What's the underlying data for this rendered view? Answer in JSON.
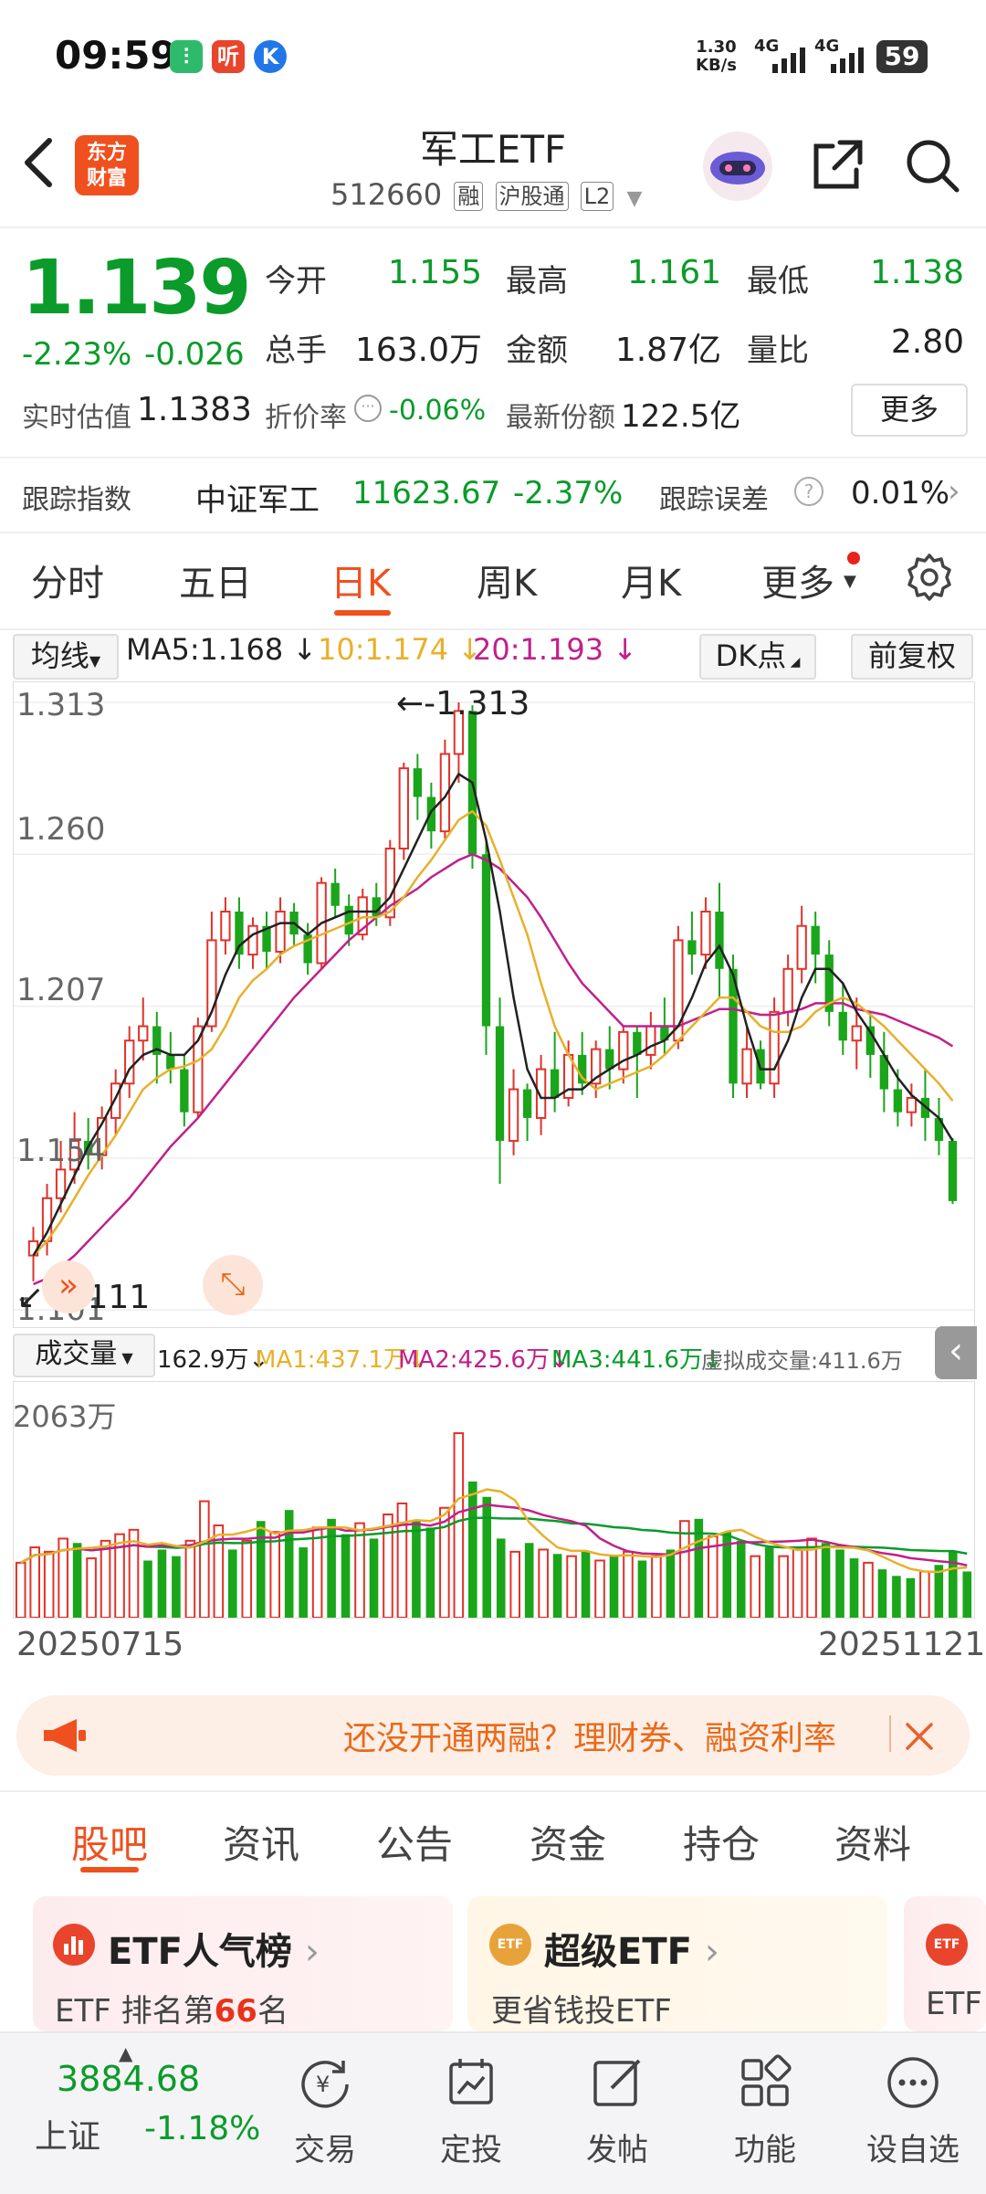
{
  "status_bar": {
    "time": "09:59",
    "net_speed": "1.30",
    "net_unit": "KB/s",
    "signal1": "4G",
    "signal2": "4G",
    "battery": "59",
    "app_icons": [
      "#2fba6b",
      "#e8452c",
      "#2176e8"
    ],
    "app_glyphs": [
      "⫶",
      "听",
      "K"
    ]
  },
  "header": {
    "logo_line1": "东方",
    "logo_line2": "财富",
    "title": "军工ETF",
    "code": "512660",
    "tags": [
      "融",
      "沪股通",
      "L2"
    ]
  },
  "quote": {
    "price": "1.139",
    "change_pct": "-2.23%",
    "change": "-0.026",
    "open_label": "今开",
    "open": "1.155",
    "high_label": "最高",
    "high": "1.161",
    "low_label": "最低",
    "low": "1.138",
    "volume_label": "总手",
    "volume": "163.0万",
    "amount_label": "金额",
    "amount": "1.87亿",
    "ratio_label": "量比",
    "ratio": "2.80",
    "iopv_label": "实时估值",
    "iopv": "1.1383",
    "discount_label": "折价率",
    "discount": "-0.06%",
    "shares_label": "最新份额",
    "shares": "122.5亿",
    "more": "更多"
  },
  "tracking": {
    "label": "跟踪指数",
    "index_name": "中证军工",
    "index_value": "11623.67",
    "index_change": "-2.37%",
    "error_label": "跟踪误差",
    "error_value": "0.01%"
  },
  "period_tabs": [
    "分时",
    "五日",
    "日K",
    "周K",
    "月K",
    "更多"
  ],
  "ma_row": {
    "selector": "均线",
    "ma5": "MA5:1.168",
    "ma10": "10:1.174",
    "ma20": "20:1.193",
    "dk": "DK点",
    "adjust": "前复权"
  },
  "chart_data": {
    "type": "candlestick",
    "y_ticks": [
      "1.313",
      "1.260",
      "1.207",
      "1.154",
      "1.101"
    ],
    "ylim": [
      1.095,
      1.32
    ],
    "max_label": "1.313",
    "min_label": "1.111",
    "x_start": "20250715",
    "x_end": "20251121",
    "candles": [
      [
        1.12,
        1.125,
        1.111,
        1.13
      ],
      [
        1.125,
        1.14,
        1.12,
        1.145
      ],
      [
        1.14,
        1.15,
        1.135,
        1.16
      ],
      [
        1.15,
        1.16,
        1.145,
        1.17
      ],
      [
        1.16,
        1.155,
        1.15,
        1.168
      ],
      [
        1.155,
        1.168,
        1.15,
        1.172
      ],
      [
        1.168,
        1.18,
        1.162,
        1.185
      ],
      [
        1.18,
        1.195,
        1.175,
        1.2
      ],
      [
        1.195,
        1.2,
        1.188,
        1.21
      ],
      [
        1.2,
        1.19,
        1.18,
        1.205
      ],
      [
        1.19,
        1.185,
        1.18,
        1.198
      ],
      [
        1.185,
        1.17,
        1.165,
        1.19
      ],
      [
        1.17,
        1.2,
        1.168,
        1.203
      ],
      [
        1.2,
        1.23,
        1.198,
        1.24
      ],
      [
        1.23,
        1.24,
        1.225,
        1.245
      ],
      [
        1.24,
        1.225,
        1.22,
        1.245
      ],
      [
        1.225,
        1.235,
        1.22,
        1.238
      ],
      [
        1.235,
        1.226,
        1.22,
        1.24
      ],
      [
        1.226,
        1.24,
        1.222,
        1.245
      ],
      [
        1.24,
        1.232,
        1.228,
        1.243
      ],
      [
        1.232,
        1.222,
        1.218,
        1.236
      ],
      [
        1.222,
        1.25,
        1.22,
        1.252
      ],
      [
        1.25,
        1.242,
        1.238,
        1.255
      ],
      [
        1.242,
        1.232,
        1.228,
        1.246
      ],
      [
        1.232,
        1.245,
        1.23,
        1.248
      ],
      [
        1.245,
        1.238,
        1.235,
        1.25
      ],
      [
        1.238,
        1.262,
        1.235,
        1.265
      ],
      [
        1.262,
        1.29,
        1.258,
        1.292
      ],
      [
        1.29,
        1.28,
        1.272,
        1.295
      ],
      [
        1.28,
        1.268,
        1.262,
        1.285
      ],
      [
        1.268,
        1.295,
        1.265,
        1.3
      ],
      [
        1.295,
        1.31,
        1.285,
        1.313
      ],
      [
        1.31,
        1.26,
        1.255,
        1.312
      ],
      [
        1.26,
        1.2,
        1.19,
        1.265
      ],
      [
        1.2,
        1.16,
        1.145,
        1.21
      ],
      [
        1.16,
        1.178,
        1.155,
        1.185
      ],
      [
        1.178,
        1.168,
        1.16,
        1.18
      ],
      [
        1.168,
        1.185,
        1.162,
        1.19
      ],
      [
        1.185,
        1.175,
        1.17,
        1.198
      ],
      [
        1.175,
        1.19,
        1.172,
        1.195
      ],
      [
        1.19,
        1.18,
        1.176,
        1.198
      ],
      [
        1.18,
        1.192,
        1.175,
        1.195
      ],
      [
        1.192,
        1.185,
        1.178,
        1.2
      ],
      [
        1.185,
        1.198,
        1.18,
        1.2
      ],
      [
        1.198,
        1.19,
        1.175,
        1.2
      ],
      [
        1.19,
        1.2,
        1.185,
        1.205
      ],
      [
        1.2,
        1.195,
        1.19,
        1.21
      ],
      [
        1.195,
        1.23,
        1.192,
        1.235
      ],
      [
        1.23,
        1.225,
        1.218,
        1.24
      ],
      [
        1.225,
        1.24,
        1.22,
        1.245
      ],
      [
        1.24,
        1.22,
        1.21,
        1.25
      ],
      [
        1.22,
        1.18,
        1.175,
        1.225
      ],
      [
        1.18,
        1.192,
        1.175,
        1.2
      ],
      [
        1.192,
        1.18,
        1.178,
        1.195
      ],
      [
        1.18,
        1.205,
        1.175,
        1.21
      ],
      [
        1.205,
        1.22,
        1.2,
        1.225
      ],
      [
        1.22,
        1.235,
        1.215,
        1.242
      ],
      [
        1.235,
        1.225,
        1.215,
        1.24
      ],
      [
        1.225,
        1.205,
        1.2,
        1.23
      ],
      [
        1.205,
        1.195,
        1.19,
        1.215
      ],
      [
        1.195,
        1.2,
        1.185,
        1.21
      ],
      [
        1.2,
        1.19,
        1.182,
        1.205
      ],
      [
        1.19,
        1.178,
        1.17,
        1.198
      ],
      [
        1.178,
        1.17,
        1.165,
        1.185
      ],
      [
        1.17,
        1.175,
        1.165,
        1.18
      ],
      [
        1.175,
        1.168,
        1.16,
        1.185
      ],
      [
        1.168,
        1.16,
        1.155,
        1.175
      ],
      [
        1.16,
        1.139,
        1.138,
        1.161
      ]
    ],
    "ma5": [
      1.12,
      1.128,
      1.138,
      1.148,
      1.158,
      1.166,
      1.175,
      1.185,
      1.19,
      1.192,
      1.19,
      1.19,
      1.195,
      1.205,
      1.218,
      1.228,
      1.232,
      1.234,
      1.236,
      1.236,
      1.232,
      1.236,
      1.238,
      1.24,
      1.24,
      1.24,
      1.245,
      1.255,
      1.265,
      1.275,
      1.28,
      1.288,
      1.285,
      1.265,
      1.24,
      1.21,
      1.185,
      1.175,
      1.175,
      1.178,
      1.178,
      1.182,
      1.185,
      1.188,
      1.19,
      1.193,
      1.195,
      1.2,
      1.21,
      1.222,
      1.228,
      1.218,
      1.2,
      1.185,
      1.185,
      1.195,
      1.21,
      1.22,
      1.22,
      1.215,
      1.205,
      1.198,
      1.19,
      1.182,
      1.176,
      1.172,
      1.168,
      1.16
    ],
    "ma10": [
      1.12,
      1.125,
      1.132,
      1.14,
      1.148,
      1.155,
      1.162,
      1.17,
      1.178,
      1.182,
      1.185,
      1.186,
      1.188,
      1.192,
      1.2,
      1.21,
      1.216,
      1.22,
      1.225,
      1.228,
      1.23,
      1.232,
      1.234,
      1.236,
      1.238,
      1.238,
      1.24,
      1.245,
      1.252,
      1.258,
      1.265,
      1.272,
      1.275,
      1.27,
      1.258,
      1.245,
      1.232,
      1.215,
      1.2,
      1.19,
      1.182,
      1.178,
      1.18,
      1.182,
      1.184,
      1.186,
      1.19,
      1.195,
      1.2,
      1.205,
      1.21,
      1.21,
      1.205,
      1.2,
      1.198,
      1.198,
      1.2,
      1.205,
      1.208,
      1.21,
      1.208,
      1.204,
      1.2,
      1.195,
      1.19,
      1.185,
      1.18,
      1.174
    ],
    "ma20": [
      1.11,
      1.112,
      1.116,
      1.12,
      1.125,
      1.13,
      1.135,
      1.14,
      1.146,
      1.152,
      1.158,
      1.163,
      1.168,
      1.174,
      1.18,
      1.186,
      1.192,
      1.198,
      1.204,
      1.21,
      1.215,
      1.22,
      1.225,
      1.23,
      1.234,
      1.238,
      1.242,
      1.245,
      1.248,
      1.252,
      1.255,
      1.258,
      1.26,
      1.258,
      1.255,
      1.25,
      1.245,
      1.238,
      1.23,
      1.222,
      1.215,
      1.21,
      1.205,
      1.2,
      1.2,
      1.2,
      1.2,
      1.2,
      1.202,
      1.204,
      1.206,
      1.206,
      1.205,
      1.204,
      1.204,
      1.205,
      1.206,
      1.208,
      1.208,
      1.208,
      1.206,
      1.205,
      1.204,
      1.202,
      1.2,
      1.198,
      1.196,
      1.193
    ],
    "volume": {
      "label": "成交量",
      "current": "162.9万",
      "ma1": "MA1:437.1万",
      "ma2": "MA2:425.6万",
      "ma3": "MA3:441.6万",
      "virtual": "虚拟成交量:411.6万",
      "max_label": "2063万",
      "values": [
        500,
        640,
        600,
        720,
        680,
        540,
        700,
        760,
        800,
        520,
        620,
        560,
        700,
        1060,
        840,
        620,
        700,
        880,
        780,
        980,
        640,
        820,
        900,
        760,
        860,
        720,
        940,
        1040,
        880,
        820,
        1000,
        1680,
        1240,
        1100,
        720,
        600,
        680,
        620,
        580,
        560,
        600,
        520,
        560,
        600,
        520,
        560,
        620,
        880,
        900,
        740,
        780,
        700,
        560,
        640,
        560,
        620,
        720,
        680,
        620,
        540,
        500,
        440,
        380,
        360,
        420,
        480,
        600,
        420
      ]
    }
  },
  "banner": {
    "text": "还没开通两融？理财券、融资利率"
  },
  "bottom_tabs": [
    "股吧",
    "资讯",
    "公告",
    "资金",
    "持仓",
    "资料"
  ],
  "cards": [
    {
      "title": "ETF人气榜",
      "sub_prefix": "ETF 排名第",
      "sub_num": "66",
      "sub_suffix": "名"
    },
    {
      "title": "超级ETF",
      "sub": "更省钱投ETF"
    },
    {
      "sub": "ETF"
    }
  ],
  "market": {
    "index_value": "3884.68",
    "index_name": "上证",
    "index_change": "-1.18%"
  },
  "nav": [
    "交易",
    "定投",
    "发帖",
    "功能",
    "设自选"
  ]
}
